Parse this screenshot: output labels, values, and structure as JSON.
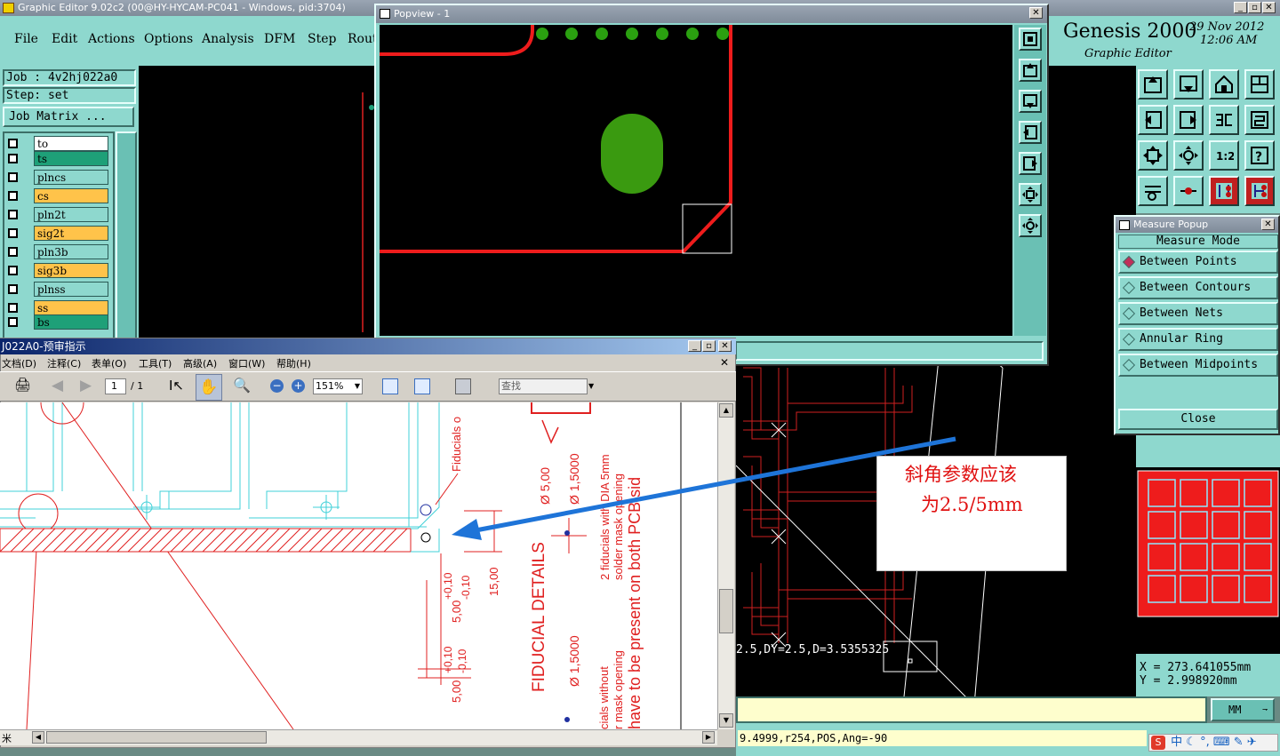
{
  "main_window": {
    "title": "Graphic Editor 9.02c2 (00@HY-HYCAM-PC041 - Windows, pid:3704)",
    "menu": [
      "File",
      "Edit",
      "Actions",
      "Options",
      "Analysis",
      "DFM",
      "Step",
      "Rout"
    ]
  },
  "brand": {
    "name": "Genesis 2000",
    "subtitle": "Graphic Editor",
    "date": "29 Nov 2012",
    "time": "12:06 AM"
  },
  "job": {
    "job_label": "Job : 4v2hj022a0",
    "step_label": "Step: set",
    "matrix_button": "Job Matrix ..."
  },
  "layers": [
    {
      "name": "to",
      "color": "#ffffff"
    },
    {
      "name": "ts",
      "color": "#1ea078"
    },
    {
      "name": "plncs",
      "color": "#8ed8ce"
    },
    {
      "name": "cs",
      "color": "#ffc34a"
    },
    {
      "name": "pln2t",
      "color": "#8ed8ce"
    },
    {
      "name": "sig2t",
      "color": "#ffc34a"
    },
    {
      "name": "pln3b",
      "color": "#8ed8ce"
    },
    {
      "name": "sig3b",
      "color": "#ffc34a"
    },
    {
      "name": "plnss",
      "color": "#8ed8ce"
    },
    {
      "name": "ss",
      "color": "#ffc34a"
    },
    {
      "name": "bs",
      "color": "#1ea078"
    }
  ],
  "popview": {
    "title": "Popview - 1"
  },
  "measure": {
    "title": "Measure Popup",
    "mode_label": "Measure Mode",
    "options": [
      "Between Points",
      "Between Contours",
      "Between Nets",
      "Annular Ring",
      "Between Midpoints"
    ],
    "selected": "Between Points",
    "close_label": "Close"
  },
  "coords": {
    "x": "X = 273.641055mm",
    "y": "Y = 2.998920mm",
    "unit": "MM"
  },
  "status": {
    "measure_text": "2.5,DY=2.5,D=3.5355325",
    "bottom_text": "9.4999,r254,POS,Ang=-90"
  },
  "annotation": {
    "line1": "斜角参数应该",
    "line2": "为2.5/5mm"
  },
  "pdf": {
    "title": "J022A0-预审指示",
    "menu": [
      "文档(D)",
      "注释(C)",
      "表单(O)",
      "工具(T)",
      "高级(A)",
      "窗口(W)",
      "帮助(H)"
    ],
    "page_current": "1",
    "page_total": "/ 1",
    "zoom": "151%",
    "search_placeholder": "查找",
    "status_left": "米",
    "drawing_texts": [
      "Fiducials o",
      "Ø 5,00",
      "Ø 1,5000",
      "2 fiducials with DIA 5mm",
      "solder mask opening",
      "FIDUCIAL DETAILS",
      "15,00",
      "5,00",
      "+0,10",
      "-0,10",
      "have to be present on both PCB sid",
      "Ø 1,5000",
      "cials without",
      "r mask opening",
      "cials"
    ]
  },
  "taskbar": {
    "ime": "中"
  }
}
